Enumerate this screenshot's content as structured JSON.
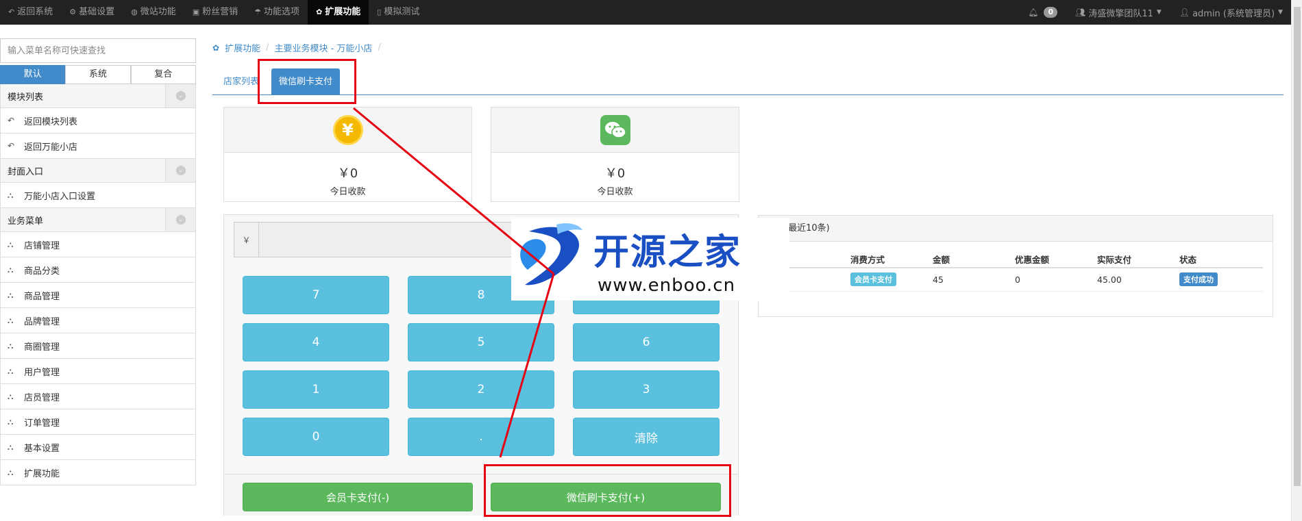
{
  "topnav": {
    "items": [
      {
        "label": "返回系统",
        "icon": "undo-icon"
      },
      {
        "label": "基础设置",
        "icon": "gear-icon"
      },
      {
        "label": "微站功能",
        "icon": "globe-icon"
      },
      {
        "label": "粉丝营销",
        "icon": "gift-icon"
      },
      {
        "label": "功能选项",
        "icon": "umbrella-icon"
      },
      {
        "label": "扩展功能",
        "icon": "cogs-icon",
        "active": true
      },
      {
        "label": "模拟测试",
        "icon": "mobile-icon"
      }
    ],
    "notification_count": "0",
    "team": "涛盛微擎团队11",
    "user": "admin (系统管理员)"
  },
  "sidebar": {
    "search_placeholder": "输入菜单名称可快速查找",
    "tabs": [
      "默认",
      "系统",
      "复合"
    ],
    "groups": [
      {
        "title": "模块列表",
        "items": [
          "返回模块列表",
          "返回万能小店"
        ]
      },
      {
        "title": "封面入口",
        "items": [
          "万能小店入口设置"
        ]
      },
      {
        "title": "业务菜单",
        "items": [
          "店铺管理",
          "商品分类",
          "商品管理",
          "品牌管理",
          "商圈管理",
          "用户管理",
          "店员管理",
          "订单管理",
          "基本设置",
          "扩展功能"
        ]
      }
    ]
  },
  "breadcrumb": {
    "items": [
      "扩展功能",
      "主要业务模块 - 万能小店"
    ],
    "separator": "/"
  },
  "tabs": {
    "list": "店家列表",
    "active": "微信刷卡支付"
  },
  "stats": [
    {
      "value": "￥0",
      "label": "今日收款",
      "icon": "coin-yuan-icon"
    },
    {
      "value": "￥0",
      "label": "今日收款",
      "icon": "wechat-icon"
    }
  ],
  "keypad": {
    "currency_prefix": "￥",
    "amount_value": "",
    "keys": [
      "7",
      "8",
      "9",
      "4",
      "5",
      "6",
      "1",
      "2",
      "3",
      "0",
      ".",
      "清除"
    ],
    "member_pay": "会员卡支付(-)",
    "wechat_pay": "微信刷卡支付(+)"
  },
  "records": {
    "title": "记录(最近10条)",
    "columns": [
      "消费方式",
      "金额",
      "优惠金额",
      "实际支付",
      "状态"
    ],
    "rows": [
      {
        "method": "会员卡支付",
        "amount": "45",
        "discount": "0",
        "actual": "45.00",
        "status": "支付成功"
      }
    ]
  },
  "watermark": {
    "title": "开源之家",
    "url": "www.enboo.cn"
  },
  "colors": {
    "primary": "#428bca",
    "info": "#5bc0de",
    "success": "#5cb85c",
    "annotation": "#e60012"
  }
}
